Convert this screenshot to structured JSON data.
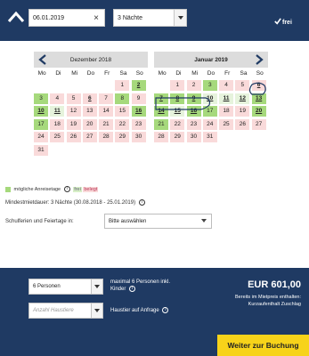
{
  "header": {
    "date_value": "06.01.2019",
    "clear_symbol": "×",
    "nights_value": "3 Nächte",
    "availability_label": "frei"
  },
  "weekdays": [
    "Mo",
    "Di",
    "Mi",
    "Do",
    "Fr",
    "Sa",
    "So"
  ],
  "calendar_left": {
    "title": "Dezember 2018",
    "days": [
      {
        "d": "",
        "s": "e"
      },
      {
        "d": "",
        "s": "e"
      },
      {
        "d": "",
        "s": "e"
      },
      {
        "d": "",
        "s": "e"
      },
      {
        "d": "",
        "s": "e"
      },
      {
        "d": "1",
        "s": "b"
      },
      {
        "d": "2",
        "s": "gu"
      },
      {
        "d": "3",
        "s": "g"
      },
      {
        "d": "4",
        "s": "b"
      },
      {
        "d": "5",
        "s": "b"
      },
      {
        "d": "6",
        "s": "bu"
      },
      {
        "d": "7",
        "s": "b"
      },
      {
        "d": "8",
        "s": "g"
      },
      {
        "d": "9",
        "s": "b"
      },
      {
        "d": "10",
        "s": "gu"
      },
      {
        "d": "11",
        "s": "fu"
      },
      {
        "d": "12",
        "s": "b"
      },
      {
        "d": "13",
        "s": "b"
      },
      {
        "d": "14",
        "s": "b"
      },
      {
        "d": "15",
        "s": "b"
      },
      {
        "d": "16",
        "s": "gu"
      },
      {
        "d": "17",
        "s": "g"
      },
      {
        "d": "18",
        "s": "b"
      },
      {
        "d": "19",
        "s": "b"
      },
      {
        "d": "20",
        "s": "b"
      },
      {
        "d": "21",
        "s": "b"
      },
      {
        "d": "22",
        "s": "b"
      },
      {
        "d": "23",
        "s": "b"
      },
      {
        "d": "24",
        "s": "b"
      },
      {
        "d": "25",
        "s": "b"
      },
      {
        "d": "26",
        "s": "b"
      },
      {
        "d": "27",
        "s": "b"
      },
      {
        "d": "28",
        "s": "b"
      },
      {
        "d": "29",
        "s": "b"
      },
      {
        "d": "30",
        "s": "b"
      },
      {
        "d": "31",
        "s": "b"
      }
    ]
  },
  "calendar_right": {
    "title": "Januar 2019",
    "days": [
      {
        "d": "",
        "s": "e"
      },
      {
        "d": "1",
        "s": "b"
      },
      {
        "d": "2",
        "s": "b"
      },
      {
        "d": "3",
        "s": "g"
      },
      {
        "d": "4",
        "s": "b"
      },
      {
        "d": "5",
        "s": "b"
      },
      {
        "d": "6",
        "s": "bu"
      },
      {
        "d": "7",
        "s": "gu"
      },
      {
        "d": "8",
        "s": "gu"
      },
      {
        "d": "9",
        "s": "gu"
      },
      {
        "d": "10",
        "s": "fu"
      },
      {
        "d": "11",
        "s": "fu"
      },
      {
        "d": "12",
        "s": "fu"
      },
      {
        "d": "13",
        "s": "gu"
      },
      {
        "d": "14",
        "s": "gu"
      },
      {
        "d": "15",
        "s": "fu"
      },
      {
        "d": "16",
        "s": "gu"
      },
      {
        "d": "17",
        "s": "g"
      },
      {
        "d": "18",
        "s": "b"
      },
      {
        "d": "19",
        "s": "b"
      },
      {
        "d": "20",
        "s": "gu"
      },
      {
        "d": "21",
        "s": "g"
      },
      {
        "d": "22",
        "s": "b"
      },
      {
        "d": "23",
        "s": "b"
      },
      {
        "d": "24",
        "s": "b"
      },
      {
        "d": "25",
        "s": "b"
      },
      {
        "d": "26",
        "s": "b"
      },
      {
        "d": "27",
        "s": "b"
      },
      {
        "d": "28",
        "s": "b"
      },
      {
        "d": "29",
        "s": "b"
      },
      {
        "d": "30",
        "s": "b"
      },
      {
        "d": "31",
        "s": "b"
      }
    ]
  },
  "legend": {
    "arrival_label": "mögliche Anreisetage",
    "frei_label": "frei",
    "belegt_label": "belegt",
    "min_stay": "Mindestmietdauer: 3 Nächte (30.08.2018 - 25.01.2019)"
  },
  "holidays": {
    "label": "Schulferien und Feiertage in:",
    "select_value": "Bitte auswählen"
  },
  "booking": {
    "persons_value": "6 Personen",
    "persons_note": "maximal 6 Personen inkl. Kinder",
    "dogs_placeholder": "Anzahl Haustiere",
    "pets_note": "Haustier auf Anfrage",
    "price": "EUR 601,00",
    "price_note_1": "Bereits im Mietpreis enthalten:",
    "price_note_2": "Kurzaufenthalt Zuschlag",
    "book_label": "Weiter zur Buchung"
  },
  "colors": {
    "navy": "#1f3a63",
    "arrival_green": "#a6d97c",
    "booked_pink": "#f9dada",
    "free_green": "#e6f3dc",
    "button_yellow": "#f7d31a"
  }
}
